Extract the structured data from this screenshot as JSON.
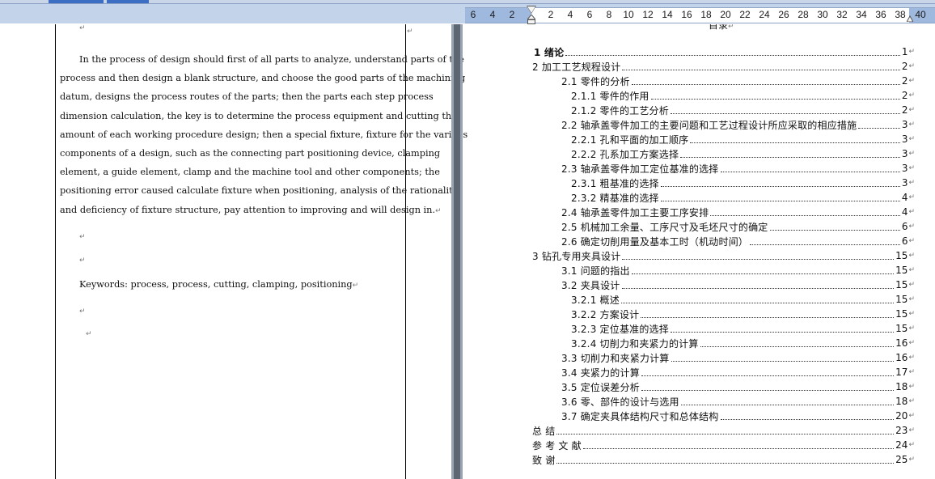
{
  "ruler": {
    "numbers": [
      "6",
      "4",
      "2",
      "2",
      "4",
      "6",
      "8",
      "10",
      "12",
      "14",
      "16",
      "18",
      "20",
      "22",
      "24",
      "26",
      "28",
      "30",
      "32",
      "34",
      "36",
      "38",
      "40"
    ]
  },
  "paragraph_mark": "↵",
  "abstract": {
    "lines": [
      "In the process of design should first of all parts to analyze, understand parts of the",
      "process and then design a blank structure, and choose the good parts of the machining",
      "datum, designs the process routes of the parts; then the parts each step process",
      "dimension calculation, the key is to determine the process equipment and cutting the",
      "amount of each working procedure design; then a special fixture, fixture for the various",
      "components of a design, such as the connecting part positioning device, clamping",
      "element, a guide element, clamp and the machine tool and other components; the",
      "positioning error caused calculate fixture when positioning, analysis of the rationality",
      "and deficiency of fixture structure, pay attention to improving and will design in."
    ],
    "keywords": "Keywords: process, process, cutting, clamping, positioning"
  },
  "toc": {
    "title": "目录",
    "entries": [
      {
        "label": "1  绪论",
        "page": "1"
      },
      {
        "label": "2  加工工艺规程设计",
        "page": "2"
      },
      {
        "label": "2.1  零件的分析",
        "page": "2"
      },
      {
        "label": "2.1.1  零件的作用",
        "page": "2"
      },
      {
        "label": "2.1.2  零件的工艺分析",
        "page": "2"
      },
      {
        "label": "2.2  轴承盖零件加工的主要问题和工艺过程设计所应采取的相应措施",
        "page": "3"
      },
      {
        "label": "2.2.1  孔和平面的加工顺序",
        "page": "3"
      },
      {
        "label": "2.2.2  孔系加工方案选择",
        "page": "3"
      },
      {
        "label": "2.3  轴承盖零件加工定位基准的选择",
        "page": "3"
      },
      {
        "label": "2.3.1  粗基准的选择",
        "page": "3"
      },
      {
        "label": "2.3.2  精基准的选择",
        "page": "4"
      },
      {
        "label": "2.4  轴承盖零件加工主要工序安排",
        "page": "4"
      },
      {
        "label": "2.5  机械加工余量、工序尺寸及毛坯尺寸的确定",
        "page": "6"
      },
      {
        "label": "2.6 确定切削用量及基本工时（机动时间）",
        "page": "6"
      },
      {
        "label": "3  钻孔专用夹具设计",
        "page": "15"
      },
      {
        "label": "3.1 问题的指出",
        "page": "15"
      },
      {
        "label": "3.2  夹具设计",
        "page": "15"
      },
      {
        "label": "3.2.1 概述",
        "page": "15"
      },
      {
        "label": "3.2.2 方案设计",
        "page": "15"
      },
      {
        "label": "3.2.3 定位基准的选择",
        "page": "15"
      },
      {
        "label": "3.2.4 切削力和夹紧力的计算",
        "page": "16"
      },
      {
        "label": "3.3 切削力和夹紧力计算",
        "page": "16"
      },
      {
        "label": "3.4 夹紧力的计算",
        "page": "17"
      },
      {
        "label": "3.5 定位误差分析",
        "page": "18"
      },
      {
        "label": "3.6 零、部件的设计与选用",
        "page": "18"
      },
      {
        "label": "3.7 确定夹具体结构尺寸和总体结构",
        "page": "20"
      },
      {
        "label": "总  结",
        "page": "23"
      },
      {
        "label": "参 考 文 献",
        "page": "24"
      },
      {
        "label": "致  谢",
        "page": "25"
      }
    ]
  }
}
